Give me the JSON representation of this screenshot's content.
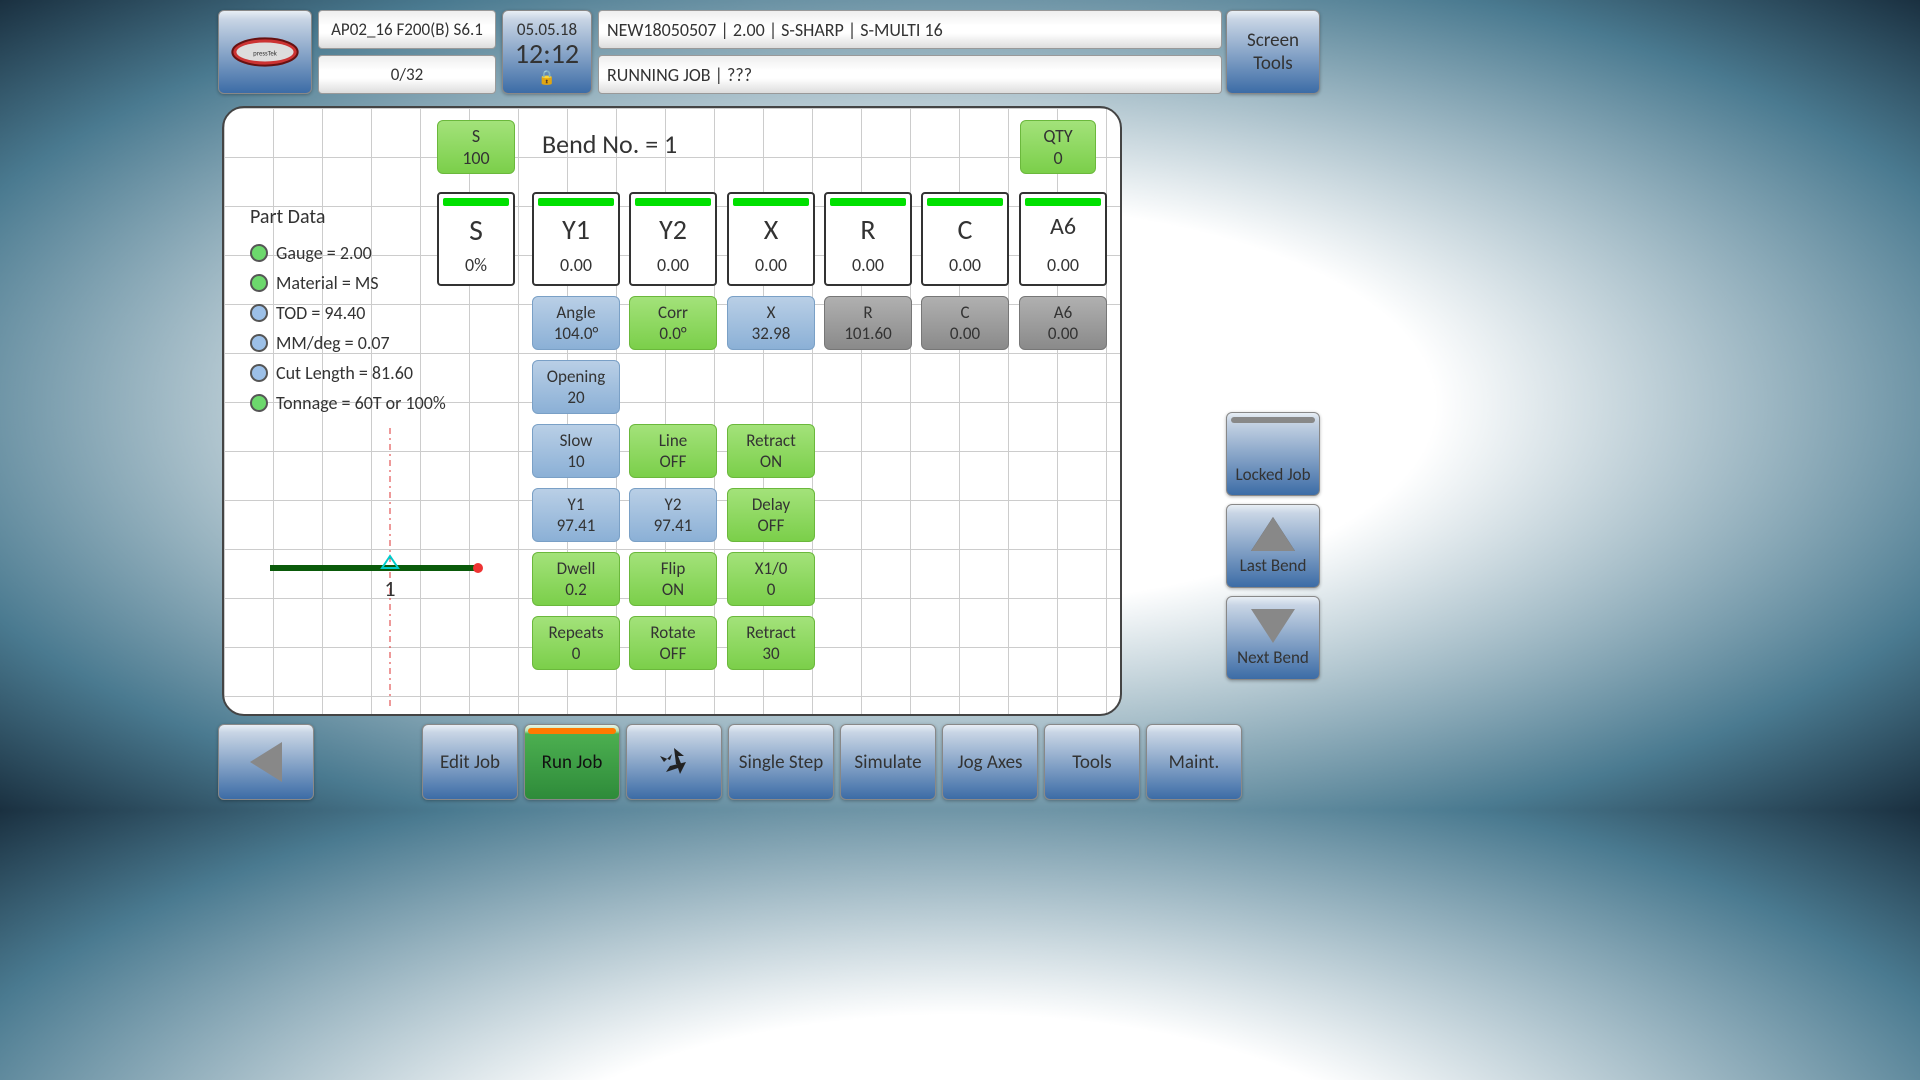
{
  "header": {
    "system_line": "AP02_16 F200(B) S6.1",
    "counter": "0/32",
    "date": "05.05.18",
    "time": "12:12",
    "job_line": "NEW18050507 | 2.00 | S-SHARP | S-MULTI 16",
    "status_line": "RUNNING JOB | ???",
    "screen_tools": "Screen\nTools"
  },
  "part_data": {
    "title": "Part Data",
    "items": [
      {
        "color": "green",
        "text": "Gauge = 2.00"
      },
      {
        "color": "green",
        "text": "Material = MS"
      },
      {
        "color": "blue",
        "text": "TOD = 94.40"
      },
      {
        "color": "blue",
        "text": "MM/deg = 0.07"
      },
      {
        "color": "blue",
        "text": "Cut Length = 81.60"
      },
      {
        "color": "green",
        "text": "Tonnage = 60T or 100%"
      }
    ]
  },
  "diagram": {
    "label": "1"
  },
  "bend_title": "Bend No. = 1",
  "s100": {
    "label": "S",
    "value": "100"
  },
  "qty": {
    "label": "QTY",
    "value": "0"
  },
  "axes": {
    "S": {
      "label": "S",
      "value": "0%"
    },
    "Y1": {
      "label": "Y1",
      "value": "0.00"
    },
    "Y2": {
      "label": "Y2",
      "value": "0.00"
    },
    "X": {
      "label": "X",
      "value": "0.00"
    },
    "R": {
      "label": "R",
      "value": "0.00"
    },
    "C": {
      "label": "C",
      "value": "0.00"
    },
    "A6": {
      "label": "A6",
      "value": "0.00"
    }
  },
  "params": {
    "angle": {
      "label": "Angle",
      "value": "104.0°"
    },
    "corr": {
      "label": "Corr",
      "value": "0.0°"
    },
    "x": {
      "label": "X",
      "value": "32.98"
    },
    "r": {
      "label": "R",
      "value": "101.60"
    },
    "c": {
      "label": "C",
      "value": "0.00"
    },
    "a6": {
      "label": "A6",
      "value": "0.00"
    },
    "opening": {
      "label": "Opening",
      "value": "20"
    },
    "slow": {
      "label": "Slow",
      "value": "10"
    },
    "line": {
      "label": "Line",
      "value": "OFF"
    },
    "retract1": {
      "label": "Retract",
      "value": "ON"
    },
    "y1": {
      "label": "Y1",
      "value": "97.41"
    },
    "y2": {
      "label": "Y2",
      "value": "97.41"
    },
    "delay": {
      "label": "Delay",
      "value": "OFF"
    },
    "dwell": {
      "label": "Dwell",
      "value": "0.2"
    },
    "flip": {
      "label": "Flip",
      "value": "ON"
    },
    "x10": {
      "label": "X1/0",
      "value": "0"
    },
    "repeats": {
      "label": "Repeats",
      "value": "0"
    },
    "rotate": {
      "label": "Rotate",
      "value": "OFF"
    },
    "retract2": {
      "label": "Retract",
      "value": "30"
    }
  },
  "side": {
    "locked": "Locked Job",
    "last": "Last Bend",
    "next": "Next Bend"
  },
  "bottom": {
    "edit": "Edit Job",
    "run": "Run Job",
    "single": "Single Step",
    "simulate": "Simulate",
    "jog": "Jog Axes",
    "tools": "Tools",
    "maint": "Maint."
  }
}
